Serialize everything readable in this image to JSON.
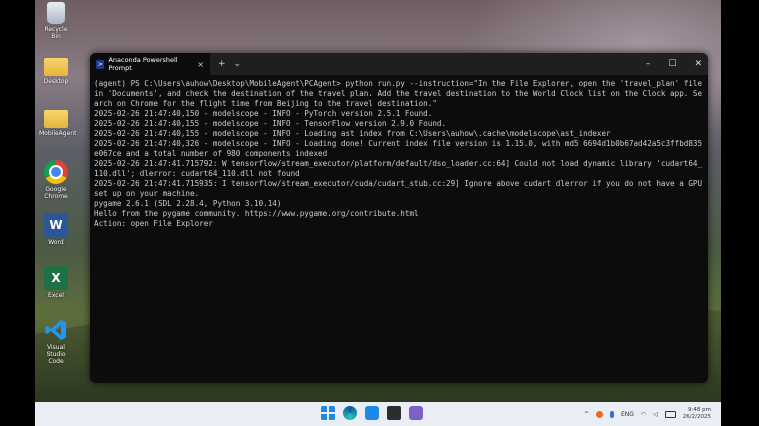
{
  "desktop": {
    "icons": [
      {
        "label": "Recycle Bin"
      },
      {
        "label": "Desktop"
      },
      {
        "label": "MobileAgent"
      },
      {
        "label": "Google Chrome"
      },
      {
        "label": "Word"
      },
      {
        "label": "Excel"
      },
      {
        "label": "Visual Studio Code"
      }
    ]
  },
  "window": {
    "tab_title": "Anaconda Powershell Prompt",
    "new_tab": "+",
    "dropdown": "⌄",
    "minimize": "–",
    "maximize": "☐",
    "close": "✕",
    "lines": [
      "(agent) PS C:\\Users\\auhow\\Desktop\\MobileAgent\\PCAgent> python run.py --instruction=\"In the File Explorer, open the 'travel_plan' file in 'Documents', and check the destination of the travel plan. Add the travel destination to the World Clock list on the Clock app. Search on Chrome for the flight time from Beijing to the travel destination.\"",
      "2025-02-26 21:47:40,150 - modelscope - INFO - PyTorch version 2.5.1 Found.",
      "2025-02-26 21:47:40,155 - modelscope - INFO - TensorFlow version 2.9.0 Found.",
      "2025-02-26 21:47:40,155 - modelscope - INFO - Loading ast index from C:\\Users\\auhow\\.cache\\modelscope\\ast_indexer",
      "2025-02-26 21:47:40,326 - modelscope - INFO - Loading done! Current index file version is 1.15.0, with md5 6694d1b0b67ad42a5c3ffbd835e067ce and a total number of 980 components indexed",
      "2025-02-26 21:47:41.715792: W tensorflow/stream_executor/platform/default/dso_loader.cc:64] Could not load dynamic library 'cudart64_110.dll'; dlerror: cudart64_110.dll not found",
      "2025-02-26 21:47:41.715935: I tensorflow/stream_executor/cuda/cudart_stub.cc:29] Ignore above cudart dlerror if you do not have a GPU set up on your machine.",
      "pygame 2.6.1 (SDL 2.28.4, Python 3.10.14)",
      "Hello from the pygame community. https://www.pygame.org/contribute.html",
      "Action: open File Explorer"
    ]
  },
  "taskbar": {
    "tray": {
      "chevron": "^",
      "lang": "ENG",
      "time": "9:48 pm",
      "date": "26/2/2025"
    }
  }
}
